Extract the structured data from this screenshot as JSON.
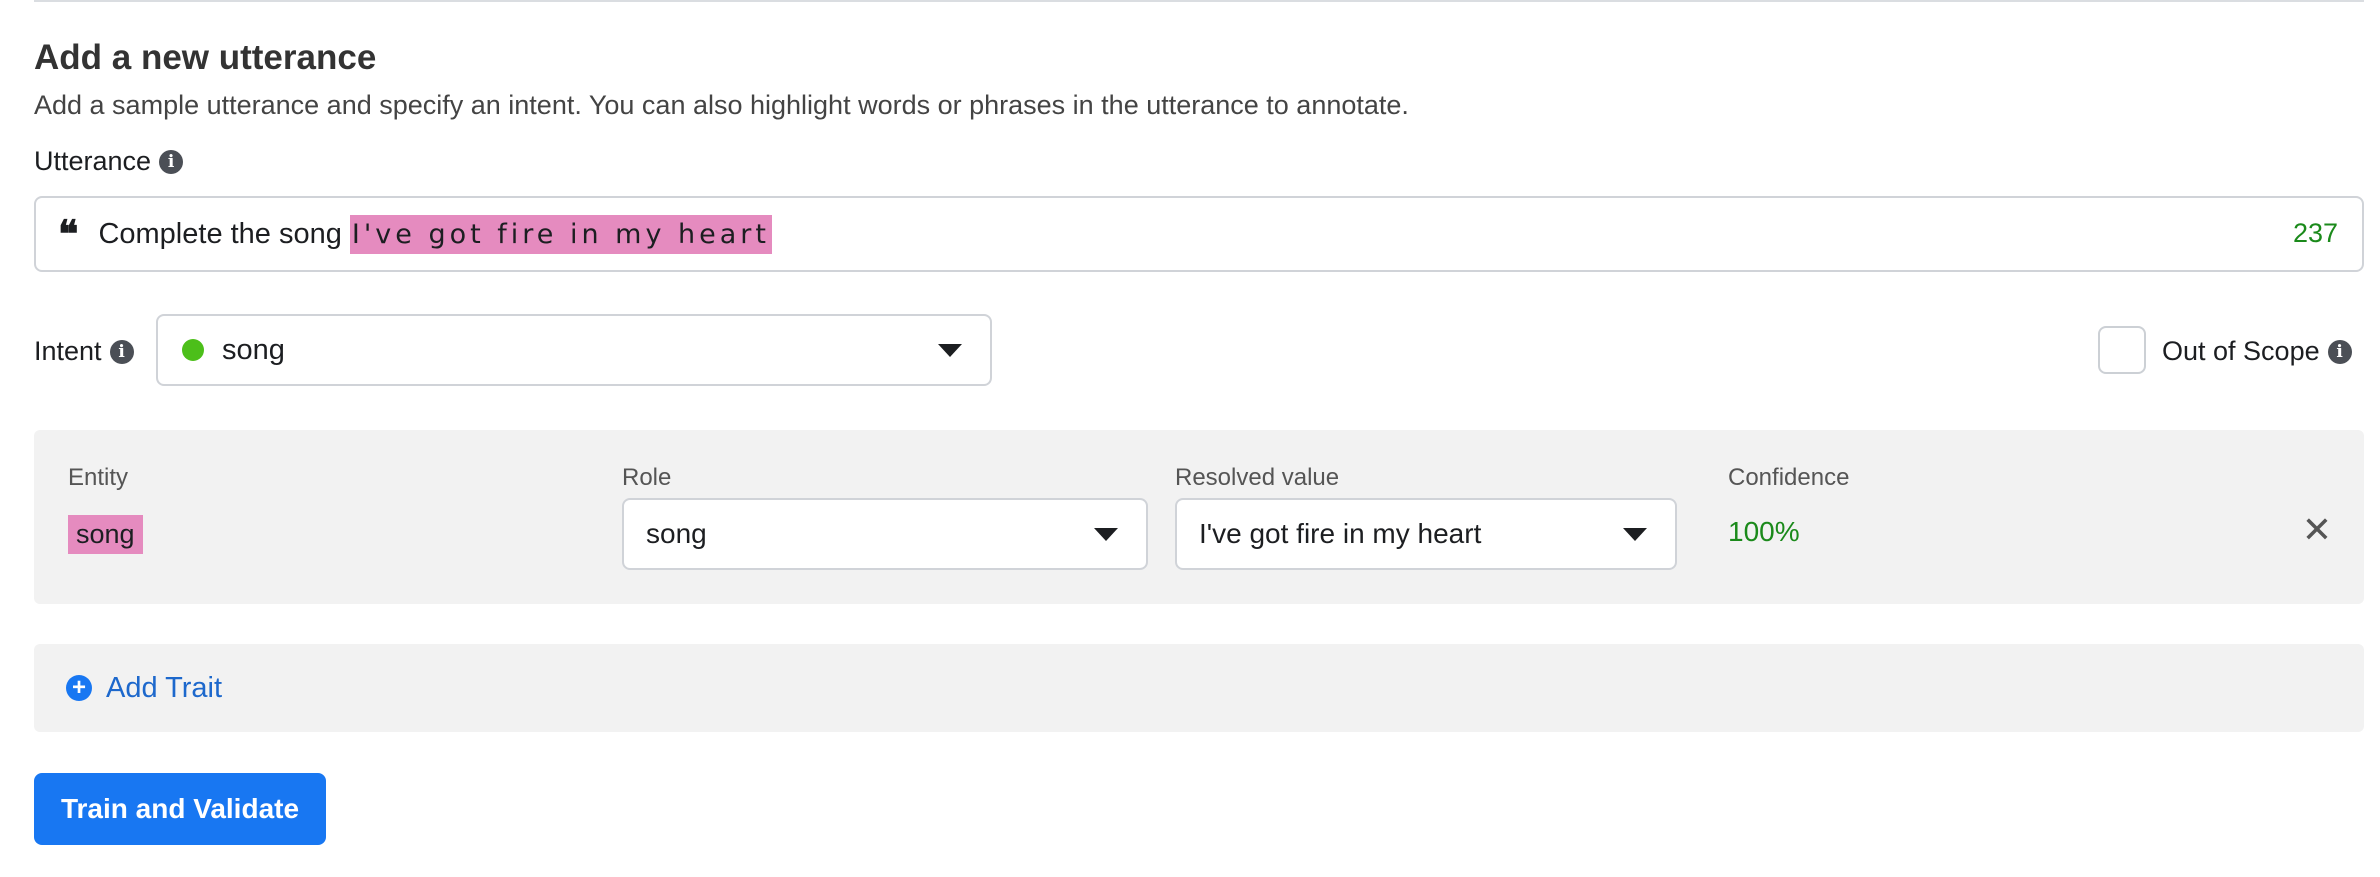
{
  "header": {
    "title": "Add a new utterance",
    "description": "Add a sample utterance and specify an intent. You can also highlight words or phrases in the utterance to annotate."
  },
  "utterance": {
    "label": "Utterance",
    "text_plain": "Complete the song",
    "text_highlighted": "I've got fire in my heart",
    "char_count": "237",
    "highlight_color": "#e58bbf"
  },
  "intent": {
    "label": "Intent",
    "value": "song",
    "dot_color": "#4cbf1a"
  },
  "out_of_scope": {
    "label": "Out of Scope",
    "checked": false
  },
  "entity_table": {
    "headers": {
      "entity": "Entity",
      "role": "Role",
      "resolved": "Resolved value",
      "confidence": "Confidence"
    },
    "row": {
      "entity": "song",
      "role": "song",
      "resolved": "I've got fire in my heart",
      "confidence": "100%"
    }
  },
  "trait": {
    "add_label": "Add Trait"
  },
  "actions": {
    "train_label": "Train and Validate"
  },
  "colors": {
    "accent": "#1877f2",
    "success": "#1b8a1b"
  }
}
